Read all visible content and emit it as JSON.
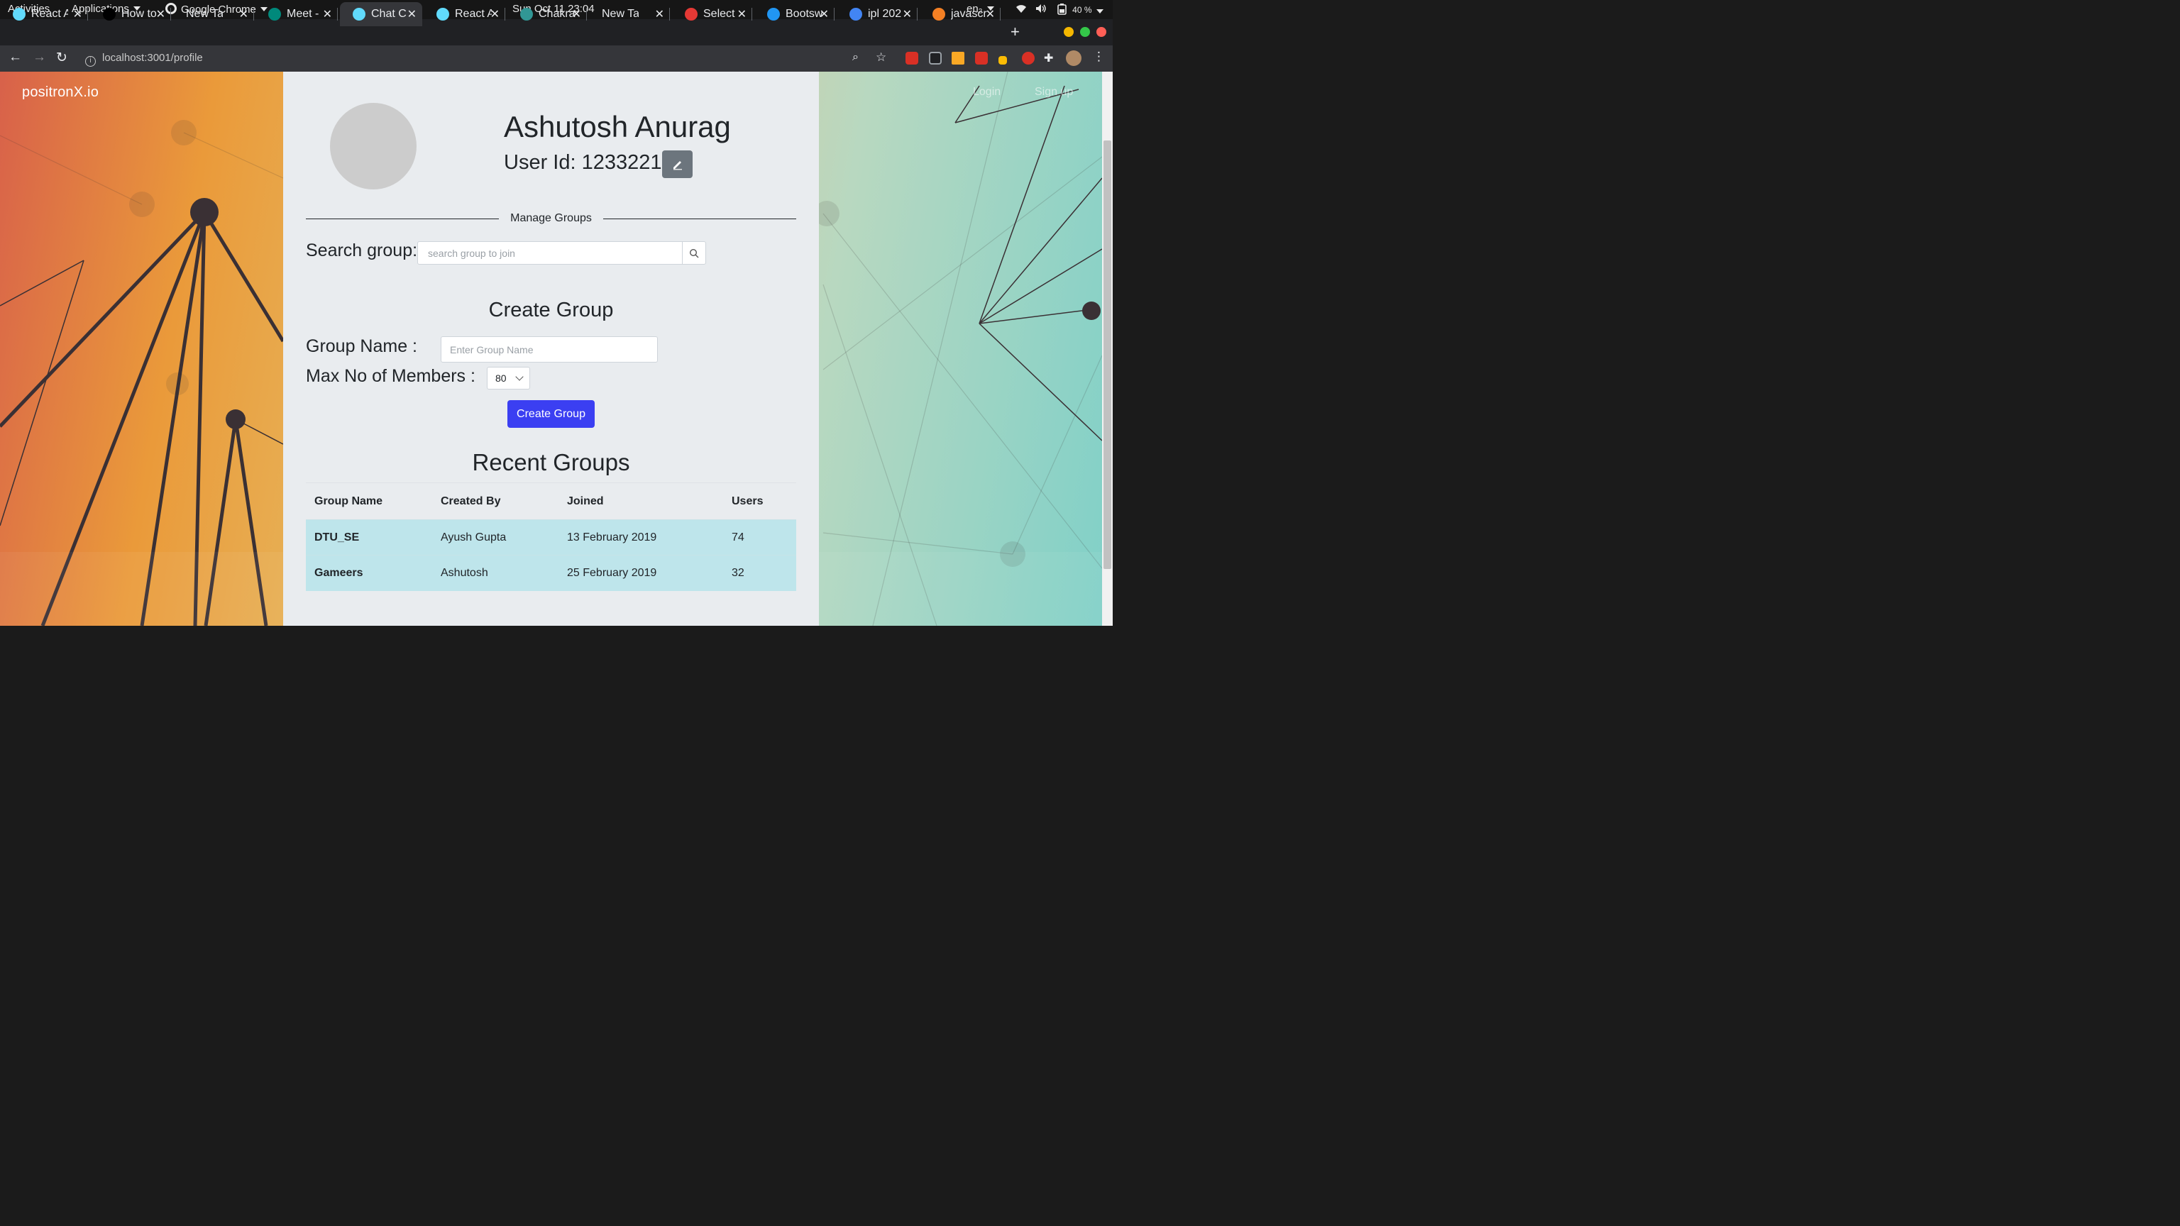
{
  "system_bar": {
    "activities": "Activities",
    "applications": "Applications",
    "app_name": "Google Chrome",
    "datetime": "Sun Oct 11  23:04",
    "language": "en₂",
    "battery": "40 %"
  },
  "tabs": [
    {
      "title": "React A",
      "favicon": "react-icon",
      "color": "#61dafb"
    },
    {
      "title": "How to",
      "favicon": "x-circle-icon",
      "color": "#000000"
    },
    {
      "title": "New Tab",
      "favicon": "",
      "color": ""
    },
    {
      "title": "Meet -",
      "favicon": "meet-icon",
      "color": "#00897b"
    },
    {
      "title": "Chat C",
      "favicon": "react-icon",
      "color": "#61dafb",
      "active": true
    },
    {
      "title": "React A",
      "favicon": "react-icon",
      "color": "#61dafb"
    },
    {
      "title": "Chakra",
      "favicon": "chakra-icon",
      "color": "#319795"
    },
    {
      "title": "New Tab",
      "favicon": "",
      "color": ""
    },
    {
      "title": "Select",
      "favicon": "diamond-icon",
      "color": "#e53935"
    },
    {
      "title": "Bootsw",
      "favicon": "bootswatch-icon",
      "color": "#2196f3"
    },
    {
      "title": "ipl 202",
      "favicon": "google-icon",
      "color": "#4285f4"
    },
    {
      "title": "javascr",
      "favicon": "stackoverflow-icon",
      "color": "#f48024"
    }
  ],
  "address_bar": {
    "url": "localhost:3001/profile"
  },
  "site": {
    "brand": "positronX.io",
    "login": "Login",
    "signup": "Sign up"
  },
  "profile": {
    "name": "Ashutosh Anurag",
    "user_id_label": "User Id: 1233221"
  },
  "manage": {
    "section_title": "Manage Groups",
    "search_label": "Search group:",
    "search_placeholder": "search group to join"
  },
  "create": {
    "title": "Create Group",
    "name_label": "Group Name :",
    "name_placeholder": "Enter Group Name",
    "max_label": "Max No of Members :",
    "max_value": "80",
    "button": "Create Group"
  },
  "recent": {
    "title": "Recent Groups",
    "columns": [
      "Group Name",
      "Created By",
      "Joined",
      "Users"
    ],
    "rows": [
      [
        "DTU_SE",
        "Ayush Gupta",
        "13 February 2019",
        "74"
      ],
      [
        "Gameers",
        "Ashutosh",
        "25 February 2019",
        "32"
      ]
    ]
  },
  "colors": {
    "primary_button": "#3b3ff2",
    "table_row": "#bee5eb",
    "panel_bg": "#e9ecef"
  }
}
